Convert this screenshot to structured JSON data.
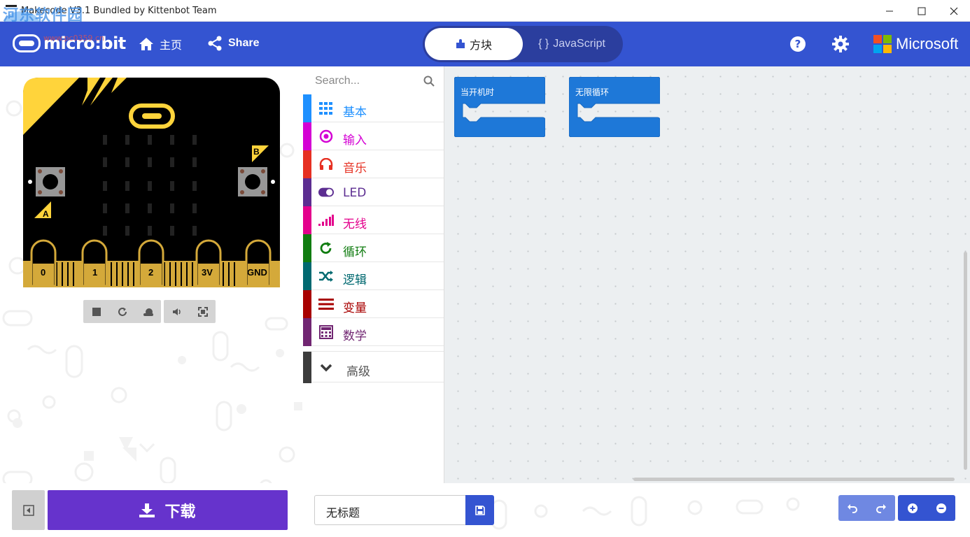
{
  "window": {
    "title": "Makecode V3.1 Bundled by Kittenbot Team",
    "watermark": "河东软件园",
    "watermark_sub": "www.pc0359.cn"
  },
  "header": {
    "brand": "micro:bit",
    "home_label": "主页",
    "share_label": "Share",
    "blocks_label": "方块",
    "javascript_label": "JavaScript",
    "microsoft_label": "Microsoft",
    "colors": {
      "header_bg": "#3454d1",
      "accent": "#6633cc"
    }
  },
  "simulator": {
    "pins": [
      "0",
      "1",
      "2",
      "3V",
      "GND"
    ],
    "button_a": "A",
    "button_b": "B"
  },
  "toolbox": {
    "search_placeholder": "Search...",
    "categories": [
      {
        "label": "基本",
        "color": "#1e90ff",
        "icon": "grid-icon"
      },
      {
        "label": "输入",
        "color": "#d400d4",
        "icon": "target-icon"
      },
      {
        "label": "音乐",
        "color": "#e63022",
        "icon": "headphones-icon"
      },
      {
        "label": "LED",
        "color": "#5c2d91",
        "icon": "toggle-icon"
      },
      {
        "label": "无线",
        "color": "#e3008c",
        "icon": "signal-bars-icon"
      },
      {
        "label": "循环",
        "color": "#107c10",
        "icon": "refresh-icon"
      },
      {
        "label": "逻辑",
        "color": "#006970",
        "icon": "shuffle-icon"
      },
      {
        "label": "变量",
        "color": "#a80000",
        "icon": "list-icon"
      },
      {
        "label": "数学",
        "color": "#712672",
        "icon": "calculator-icon"
      }
    ],
    "advanced_label": "高级"
  },
  "workspace": {
    "blocks": [
      {
        "label": "当开机时"
      },
      {
        "label": "无限循环"
      }
    ]
  },
  "bottom": {
    "download_label": "下载",
    "project_name": "无标题"
  }
}
